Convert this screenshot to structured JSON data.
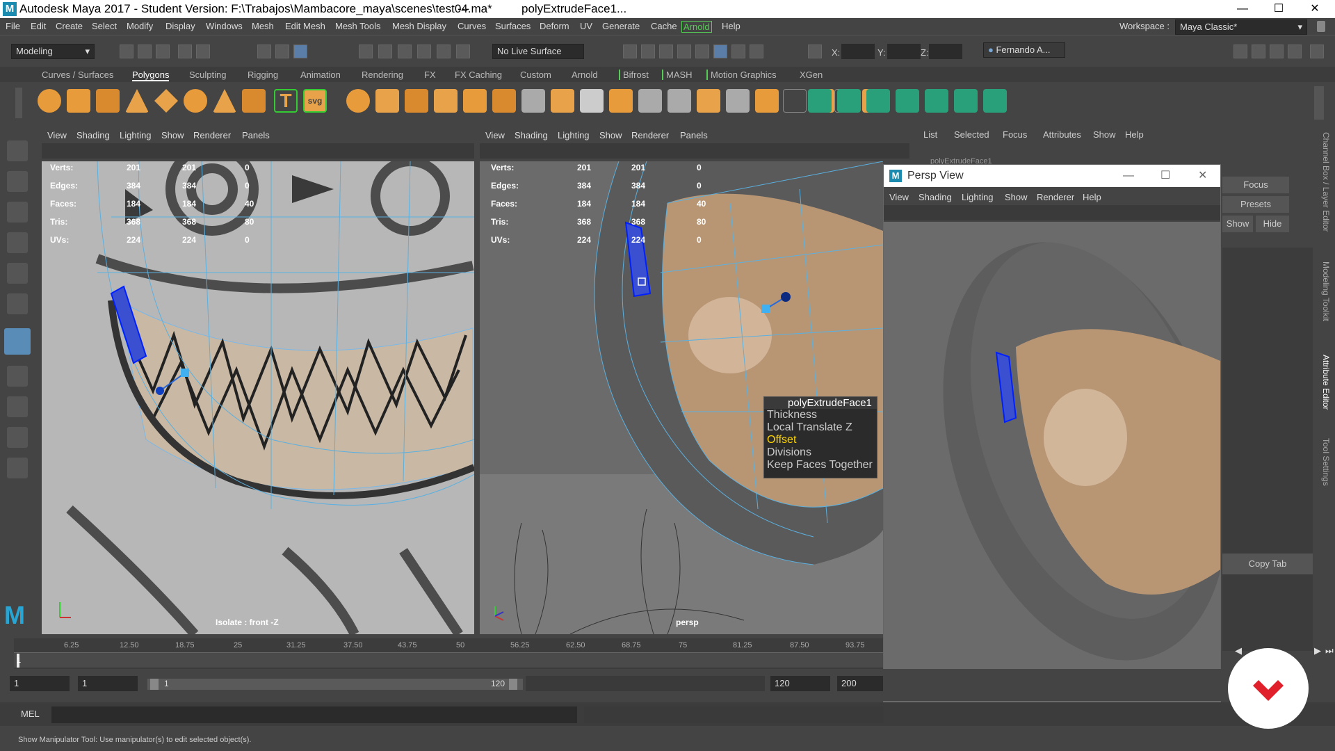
{
  "titlebar": {
    "logo": "M",
    "title": "Autodesk Maya 2017 - Student Version: F:\\Trabajos\\Mambacore_maya\\scenes\\test04.ma*",
    "separator": "---",
    "node": "polyExtrudeFace1...",
    "minimize": "—",
    "maximize": "☐",
    "close": "✕"
  },
  "menubar": {
    "items": [
      "File",
      "Edit",
      "Create",
      "Select",
      "Modify",
      "Display",
      "Windows",
      "Mesh",
      "Edit Mesh",
      "Mesh Tools",
      "Mesh Display",
      "Curves",
      "Surfaces",
      "Deform",
      "UV",
      "Generate",
      "Cache",
      "Arnold",
      "Help"
    ],
    "workspace_label": "Workspace :",
    "workspace_value": "Maya Classic*"
  },
  "statusline": {
    "mode": "Modeling",
    "live_surface": "No Live Surface",
    "x_label": "X:",
    "y_label": "Y:",
    "z_label": "Z:",
    "user": "Fernando A..."
  },
  "shelf": {
    "tabs": [
      "Curves / Surfaces",
      "Polygons",
      "Sculpting",
      "Rigging",
      "Animation",
      "Rendering",
      "FX",
      "FX Caching",
      "Custom",
      "Arnold",
      "Bifrost",
      "MASH",
      "Motion Graphics",
      "XGen"
    ],
    "active_tab": "Polygons"
  },
  "viewport1": {
    "menu": [
      "View",
      "Shading",
      "Lighting",
      "Show",
      "Renderer",
      "Panels"
    ],
    "hud_rows": [
      {
        "label": "Verts:",
        "a": "201",
        "b": "201",
        "c": "0"
      },
      {
        "label": "Edges:",
        "a": "384",
        "b": "384",
        "c": "0"
      },
      {
        "label": "Faces:",
        "a": "184",
        "b": "184",
        "c": "40"
      },
      {
        "label": "Tris:",
        "a": "368",
        "b": "368",
        "c": "80"
      },
      {
        "label": "UVs:",
        "a": "224",
        "b": "224",
        "c": "0"
      }
    ],
    "camera_label": "Isolate : front -Z"
  },
  "viewport2": {
    "menu": [
      "View",
      "Shading",
      "Lighting",
      "Show",
      "Renderer",
      "Panels"
    ],
    "hud_rows": [
      {
        "label": "Verts:",
        "a": "201",
        "b": "201",
        "c": "0"
      },
      {
        "label": "Edges:",
        "a": "384",
        "b": "384",
        "c": "0"
      },
      {
        "label": "Faces:",
        "a": "184",
        "b": "184",
        "c": "40"
      },
      {
        "label": "Tris:",
        "a": "368",
        "b": "368",
        "c": "80"
      },
      {
        "label": "UVs:",
        "a": "224",
        "b": "224",
        "c": "0"
      }
    ],
    "camera_label": "persp",
    "popup": {
      "title": "polyExtrudeFace1",
      "items": [
        "Thickness",
        "Local Translate Z",
        "Offset",
        "Divisions",
        "Keep Faces Together"
      ],
      "highlighted": "Offset"
    }
  },
  "attribute_editor": {
    "menu": [
      "List",
      "Selected",
      "Focus",
      "Attributes",
      "Show",
      "Help"
    ],
    "node_tab": "polyExtrudeFace1",
    "buttons": {
      "focus": "Focus",
      "presets": "Presets",
      "show": "Show",
      "hide": "Hide",
      "copy_tab": "Copy Tab"
    },
    "side_tabs": [
      "Channel Box / Layer Editor",
      "Modeling Toolkit",
      "Attribute Editor",
      "Tool Settings"
    ]
  },
  "persp_window": {
    "logo": "M",
    "title": "Persp View",
    "menu": [
      "View",
      "Shading",
      "Lighting",
      "Show",
      "Renderer",
      "Help"
    ]
  },
  "timeline": {
    "ticks": [
      "6.25",
      "12.50",
      "18.75",
      "25",
      "31.25",
      "37.50",
      "43.75",
      "50",
      "56.25",
      "62.50",
      "68.75",
      "75",
      "81.25",
      "87.50",
      "93.75"
    ],
    "current": "1"
  },
  "range": {
    "start": "1",
    "playback_start": "1",
    "slider_start": "1",
    "slider_end": "120",
    "playback_end": "120",
    "end": "200"
  },
  "cmdline": {
    "label": "MEL"
  },
  "helpline": {
    "text": "Show Manipulator Tool: Use manipulator(s) to edit selected object(s)."
  }
}
